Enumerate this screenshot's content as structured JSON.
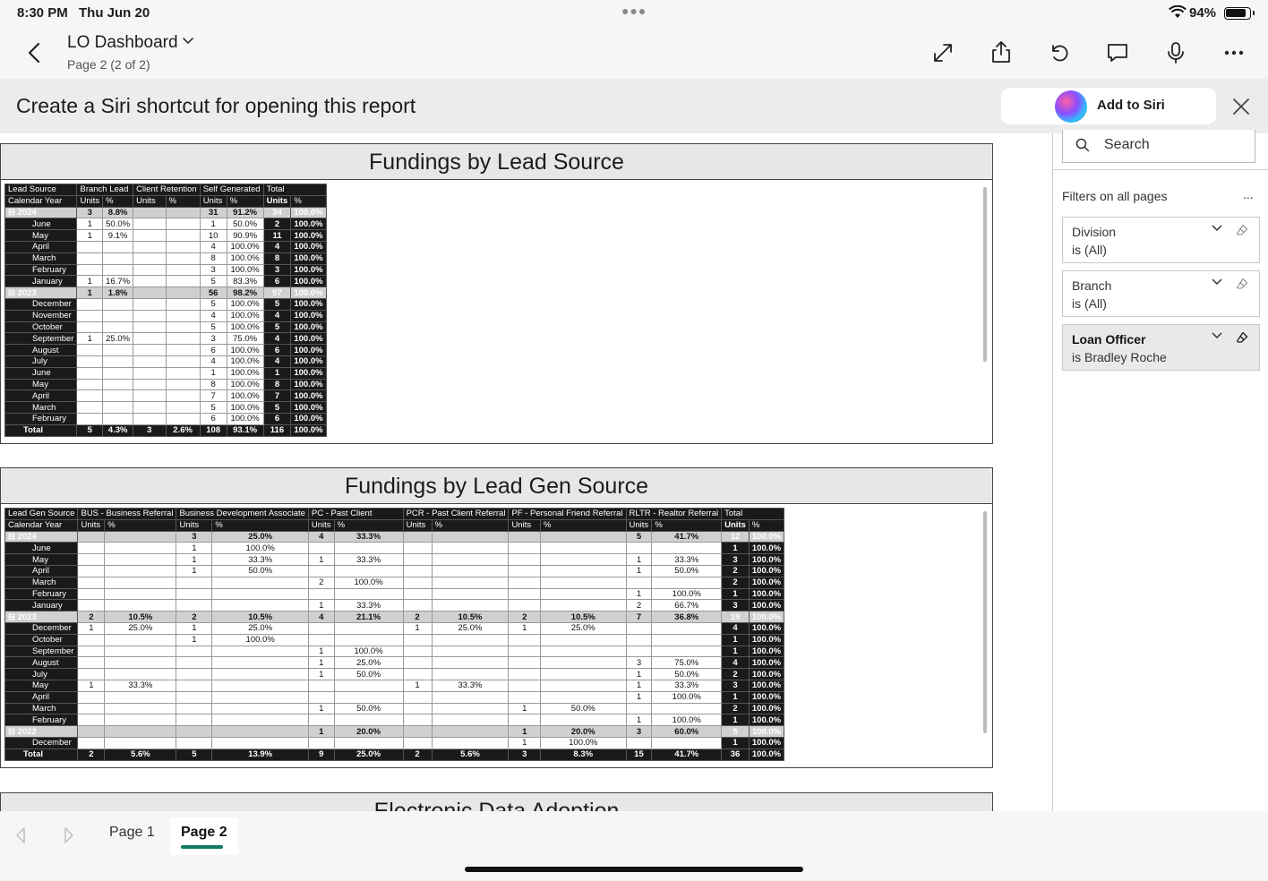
{
  "status": {
    "time": "8:30 PM",
    "date": "Thu Jun 20",
    "battery": "94%"
  },
  "header": {
    "title": "LO Dashboard",
    "subtitle": "Page 2 (2 of 2)"
  },
  "siri": {
    "text": "Create a Siri shortcut for opening this report",
    "button_label": "Add to Siri"
  },
  "visual1": {
    "title": "Fundings by Lead Source",
    "corner_top": "Lead Source",
    "corner_bottom": "Calendar Year",
    "groups": [
      "Branch Lead",
      "Client Retention",
      "Self Generated",
      "Total"
    ],
    "units_label": "Units",
    "pct_label": "%",
    "rows": [
      {
        "label": "2024",
        "year": true,
        "cells": [
          "3",
          "8.8%",
          "",
          "",
          "31",
          "91.2%",
          "34",
          "100.0%"
        ]
      },
      {
        "label": "June",
        "cells": [
          "1",
          "50.0%",
          "",
          "",
          "1",
          "50.0%",
          "2",
          "100.0%"
        ]
      },
      {
        "label": "May",
        "cells": [
          "1",
          "9.1%",
          "",
          "",
          "10",
          "90.9%",
          "11",
          "100.0%"
        ]
      },
      {
        "label": "April",
        "cells": [
          "",
          "",
          "",
          "",
          "4",
          "100.0%",
          "4",
          "100.0%"
        ]
      },
      {
        "label": "March",
        "cells": [
          "",
          "",
          "",
          "",
          "8",
          "100.0%",
          "8",
          "100.0%"
        ]
      },
      {
        "label": "February",
        "cells": [
          "",
          "",
          "",
          "",
          "3",
          "100.0%",
          "3",
          "100.0%"
        ]
      },
      {
        "label": "January",
        "cells": [
          "1",
          "16.7%",
          "",
          "",
          "5",
          "83.3%",
          "6",
          "100.0%"
        ]
      },
      {
        "label": "2023",
        "year": true,
        "cells": [
          "1",
          "1.8%",
          "",
          "",
          "56",
          "98.2%",
          "57",
          "100.0%"
        ]
      },
      {
        "label": "December",
        "cells": [
          "",
          "",
          "",
          "",
          "5",
          "100.0%",
          "5",
          "100.0%"
        ]
      },
      {
        "label": "November",
        "cells": [
          "",
          "",
          "",
          "",
          "4",
          "100.0%",
          "4",
          "100.0%"
        ]
      },
      {
        "label": "October",
        "cells": [
          "",
          "",
          "",
          "",
          "5",
          "100.0%",
          "5",
          "100.0%"
        ]
      },
      {
        "label": "September",
        "cells": [
          "1",
          "25.0%",
          "",
          "",
          "3",
          "75.0%",
          "4",
          "100.0%"
        ]
      },
      {
        "label": "August",
        "cells": [
          "",
          "",
          "",
          "",
          "6",
          "100.0%",
          "6",
          "100.0%"
        ]
      },
      {
        "label": "July",
        "cells": [
          "",
          "",
          "",
          "",
          "4",
          "100.0%",
          "4",
          "100.0%"
        ]
      },
      {
        "label": "June",
        "cells": [
          "",
          "",
          "",
          "",
          "1",
          "100.0%",
          "1",
          "100.0%"
        ]
      },
      {
        "label": "May",
        "cells": [
          "",
          "",
          "",
          "",
          "8",
          "100.0%",
          "8",
          "100.0%"
        ]
      },
      {
        "label": "April",
        "cells": [
          "",
          "",
          "",
          "",
          "7",
          "100.0%",
          "7",
          "100.0%"
        ]
      },
      {
        "label": "March",
        "cells": [
          "",
          "",
          "",
          "",
          "5",
          "100.0%",
          "5",
          "100.0%"
        ]
      },
      {
        "label": "February",
        "cells": [
          "",
          "",
          "",
          "",
          "6",
          "100.0%",
          "6",
          "100.0%"
        ]
      },
      {
        "label": "Total",
        "total": true,
        "cells": [
          "5",
          "4.3%",
          "3",
          "2.6%",
          "108",
          "93.1%",
          "116",
          "100.0%"
        ]
      }
    ]
  },
  "visual2": {
    "title": "Fundings by Lead Gen Source",
    "corner_top": "Lead Gen Source",
    "corner_bottom": "Calendar Year",
    "groups": [
      "BUS - Business Referral",
      "Business Development Associate",
      "PC - Past Client",
      "PCR - Past Client Referral",
      "PF - Personal Friend Referral",
      "RLTR - Realtor Referral",
      "Total"
    ],
    "units_label": "Units",
    "pct_label": "%",
    "rows": [
      {
        "label": "2024",
        "year": true,
        "cells": [
          "",
          "",
          "3",
          "25.0%",
          "4",
          "33.3%",
          "",
          "",
          "",
          "",
          "5",
          "41.7%",
          "12",
          "100.0%"
        ]
      },
      {
        "label": "June",
        "cells": [
          "",
          "",
          "1",
          "100.0%",
          "",
          "",
          "",
          "",
          "",
          "",
          "",
          "",
          "1",
          "100.0%"
        ]
      },
      {
        "label": "May",
        "cells": [
          "",
          "",
          "1",
          "33.3%",
          "1",
          "33.3%",
          "",
          "",
          "",
          "",
          "1",
          "33.3%",
          "3",
          "100.0%"
        ]
      },
      {
        "label": "April",
        "cells": [
          "",
          "",
          "1",
          "50.0%",
          "",
          "",
          "",
          "",
          "",
          "",
          "1",
          "50.0%",
          "2",
          "100.0%"
        ]
      },
      {
        "label": "March",
        "cells": [
          "",
          "",
          "",
          "",
          "2",
          "100.0%",
          "",
          "",
          "",
          "",
          "",
          "",
          "2",
          "100.0%"
        ]
      },
      {
        "label": "February",
        "cells": [
          "",
          "",
          "",
          "",
          "",
          "",
          "",
          "",
          "",
          "",
          "1",
          "100.0%",
          "1",
          "100.0%"
        ]
      },
      {
        "label": "January",
        "cells": [
          "",
          "",
          "",
          "",
          "1",
          "33.3%",
          "",
          "",
          "",
          "",
          "2",
          "66.7%",
          "3",
          "100.0%"
        ]
      },
      {
        "label": "2023",
        "year": true,
        "cells": [
          "2",
          "10.5%",
          "2",
          "10.5%",
          "4",
          "21.1%",
          "2",
          "10.5%",
          "2",
          "10.5%",
          "7",
          "36.8%",
          "19",
          "100.0%"
        ]
      },
      {
        "label": "December",
        "cells": [
          "1",
          "25.0%",
          "1",
          "25.0%",
          "",
          "",
          "1",
          "25.0%",
          "1",
          "25.0%",
          "",
          "",
          "4",
          "100.0%"
        ]
      },
      {
        "label": "October",
        "cells": [
          "",
          "",
          "1",
          "100.0%",
          "",
          "",
          "",
          "",
          "",
          "",
          "",
          "",
          "1",
          "100.0%"
        ]
      },
      {
        "label": "September",
        "cells": [
          "",
          "",
          "",
          "",
          "1",
          "100.0%",
          "",
          "",
          "",
          "",
          "",
          "",
          "1",
          "100.0%"
        ]
      },
      {
        "label": "August",
        "cells": [
          "",
          "",
          "",
          "",
          "1",
          "25.0%",
          "",
          "",
          "",
          "",
          "3",
          "75.0%",
          "4",
          "100.0%"
        ]
      },
      {
        "label": "July",
        "cells": [
          "",
          "",
          "",
          "",
          "1",
          "50.0%",
          "",
          "",
          "",
          "",
          "1",
          "50.0%",
          "2",
          "100.0%"
        ]
      },
      {
        "label": "May",
        "cells": [
          "1",
          "33.3%",
          "",
          "",
          "",
          "",
          "1",
          "33.3%",
          "",
          "",
          "1",
          "33.3%",
          "3",
          "100.0%"
        ]
      },
      {
        "label": "April",
        "cells": [
          "",
          "",
          "",
          "",
          "",
          "",
          "",
          "",
          "",
          "",
          "1",
          "100.0%",
          "1",
          "100.0%"
        ]
      },
      {
        "label": "March",
        "cells": [
          "",
          "",
          "",
          "",
          "1",
          "50.0%",
          "",
          "",
          "1",
          "50.0%",
          "",
          "",
          "2",
          "100.0%"
        ]
      },
      {
        "label": "February",
        "cells": [
          "",
          "",
          "",
          "",
          "",
          "",
          "",
          "",
          "",
          "",
          "1",
          "100.0%",
          "1",
          "100.0%"
        ]
      },
      {
        "label": "2022",
        "year": true,
        "cells": [
          "",
          "",
          "",
          "",
          "1",
          "20.0%",
          "",
          "",
          "1",
          "20.0%",
          "3",
          "60.0%",
          "5",
          "100.0%"
        ]
      },
      {
        "label": "December",
        "cells": [
          "",
          "",
          "",
          "",
          "",
          "",
          "",
          "",
          "1",
          "100.0%",
          "",
          "",
          "1",
          "100.0%"
        ]
      },
      {
        "label": "Total",
        "total": true,
        "cells": [
          "2",
          "5.6%",
          "5",
          "13.9%",
          "9",
          "25.0%",
          "2",
          "5.6%",
          "3",
          "8.3%",
          "15",
          "41.7%",
          "36",
          "100.0%"
        ]
      }
    ]
  },
  "visual3": {
    "title": "Electronic Data Adoption"
  },
  "filters": {
    "search_placeholder": "Search",
    "title": "Filters on all pages",
    "more": "...",
    "cards": [
      {
        "name": "Division",
        "value": "is (All)",
        "active": false
      },
      {
        "name": "Branch",
        "value": "is (All)",
        "active": false
      },
      {
        "name": "Loan Officer",
        "value": "is Bradley Roche",
        "active": true
      }
    ]
  },
  "pages": {
    "page1": "Page 1",
    "page2": "Page 2"
  },
  "colors": {
    "accent": "#117865",
    "matrix_header": "#1a1a1a",
    "year_row": "#d0d0d0"
  }
}
